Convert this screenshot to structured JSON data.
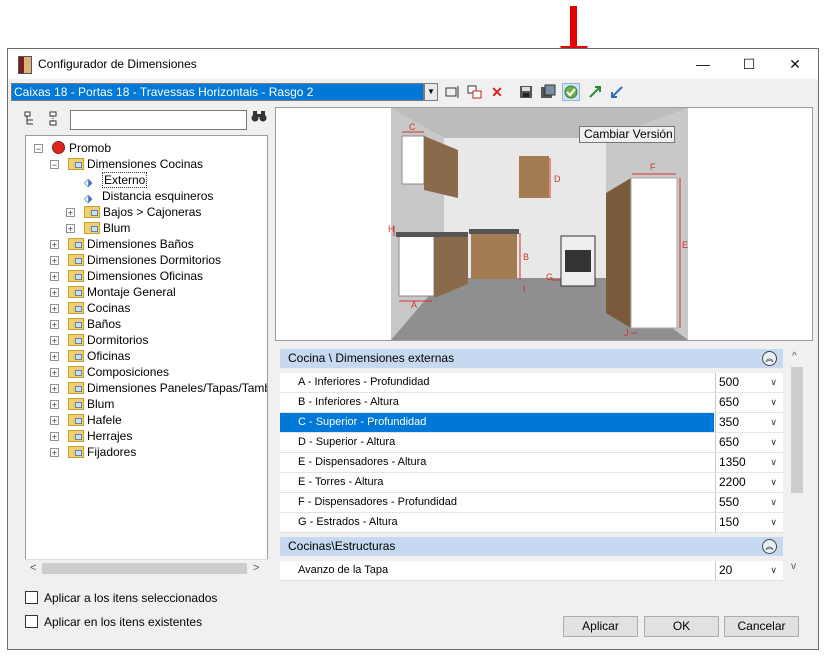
{
  "window": {
    "title": "Configurador de Dimensiones",
    "minimize": "—",
    "maximize": "☐",
    "close": "✕"
  },
  "toolbar": {
    "configuration_value": "Caixas 18 - Portas 18 - Travessas Horizontais - Rasgo 2",
    "icons": [
      "edit-icon",
      "copy-icon",
      "delete-icon",
      "save-icon",
      "save-as-icon",
      "change-version-icon",
      "export-icon",
      "import-icon"
    ]
  },
  "tooltip": "Cambiar Versión",
  "tree": {
    "search_value": "",
    "items": [
      {
        "label": "Promob",
        "level": 0,
        "expander": "−",
        "icon": "promob"
      },
      {
        "label": "Dimensiones Cocinas",
        "level": 1,
        "expander": "−",
        "icon": "folder"
      },
      {
        "label": "Externo",
        "level": 2,
        "expander": "",
        "icon": "tag"
      },
      {
        "label": "Distancia esquineros",
        "level": 2,
        "expander": "",
        "icon": "tag"
      },
      {
        "label": "Bajos > Cajoneras",
        "level": 2,
        "expander": "+",
        "icon": "folder"
      },
      {
        "label": "Blum",
        "level": 2,
        "expander": "+",
        "icon": "folder"
      },
      {
        "label": "Dimensiones Baños",
        "level": 1,
        "expander": "+",
        "icon": "folder"
      },
      {
        "label": "Dimensiones Dormitorios",
        "level": 1,
        "expander": "+",
        "icon": "folder"
      },
      {
        "label": "Dimensiones Oficinas",
        "level": 1,
        "expander": "+",
        "icon": "folder"
      },
      {
        "label": "Montaje General",
        "level": 1,
        "expander": "+",
        "icon": "folder"
      },
      {
        "label": "Cocinas",
        "level": 1,
        "expander": "+",
        "icon": "folder"
      },
      {
        "label": "Baños",
        "level": 1,
        "expander": "+",
        "icon": "folder"
      },
      {
        "label": "Dormitorios",
        "level": 1,
        "expander": "+",
        "icon": "folder"
      },
      {
        "label": "Oficinas",
        "level": 1,
        "expander": "+",
        "icon": "folder"
      },
      {
        "label": "Composiciones",
        "level": 1,
        "expander": "+",
        "icon": "folder"
      },
      {
        "label": "Dimensiones Paneles/Tapas/Tambur",
        "level": 1,
        "expander": "+",
        "icon": "folder"
      },
      {
        "label": "Blum",
        "level": 1,
        "expander": "+",
        "icon": "folder"
      },
      {
        "label": "Hafele",
        "level": 1,
        "expander": "+",
        "icon": "folder"
      },
      {
        "label": "Herrajes",
        "level": 1,
        "expander": "+",
        "icon": "folder"
      },
      {
        "label": "Fijadores",
        "level": 1,
        "expander": "+",
        "icon": "folder"
      }
    ]
  },
  "preview": {
    "labels": [
      "C",
      "D",
      "F",
      "H",
      "B",
      "E",
      "G",
      "I",
      "A",
      "J"
    ]
  },
  "properties": {
    "group1_title": "Cocina \\ Dimensiones externas",
    "rows": [
      {
        "label": "A - Inferiores - Profundidad",
        "value": "500"
      },
      {
        "label": "B - Inferiores - Altura",
        "value": "650"
      },
      {
        "label": "C - Superior - Profundidad",
        "value": "350",
        "selected": true
      },
      {
        "label": "D - Superior - Altura",
        "value": "650"
      },
      {
        "label": "E - Dispensadores - Altura",
        "value": "1350"
      },
      {
        "label": "E - Torres - Altura",
        "value": "2200"
      },
      {
        "label": "F - Dispensadores - Profundidad",
        "value": "550"
      },
      {
        "label": "G - Estrados - Altura",
        "value": "150"
      }
    ],
    "group2_title": "Cocinas\\Estructuras",
    "rows2": [
      {
        "label": "Avanzo de la Tapa",
        "value": "20"
      }
    ]
  },
  "options": {
    "apply_selected": "Aplicar a los itens seleccionados",
    "apply_existing": "Aplicar en los itens existentes"
  },
  "buttons": {
    "apply": "Aplicar",
    "ok": "OK",
    "cancel": "Cancelar"
  },
  "colors": {
    "selection": "#0078d7",
    "group_header": "#c7d9f1",
    "annotation_arrow": "#e60000"
  }
}
